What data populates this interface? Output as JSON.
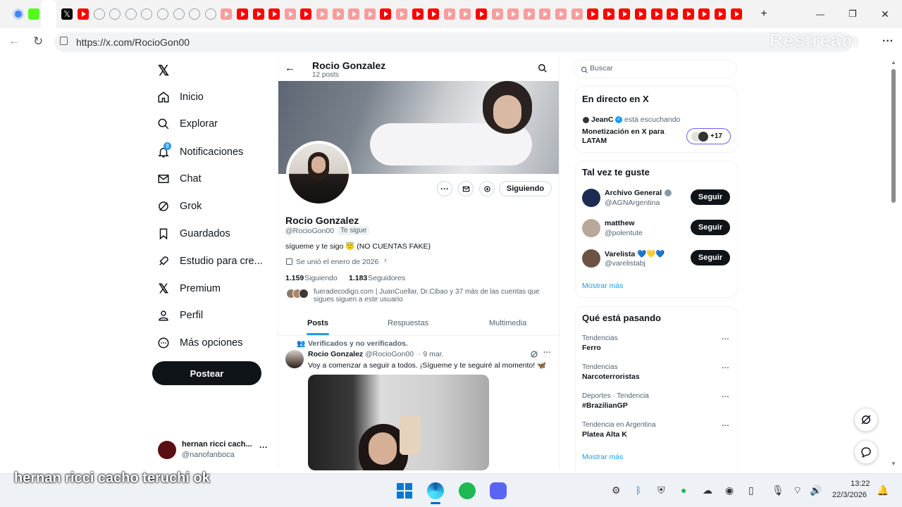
{
  "browser": {
    "url": "https://x.com/RocioGon00",
    "watermark": "Restream",
    "new_tab": "+",
    "min": "—",
    "restore": "❐",
    "close": "✕"
  },
  "nav": {
    "items": [
      {
        "label": "Inicio",
        "icon": "home-icon"
      },
      {
        "label": "Explorar",
        "icon": "search-icon"
      },
      {
        "label": "Notificaciones",
        "icon": "bell-icon",
        "badge": "8"
      },
      {
        "label": "Chat",
        "icon": "mail-icon"
      },
      {
        "label": "Grok",
        "icon": "grok-icon"
      },
      {
        "label": "Guardados",
        "icon": "bookmark-icon"
      },
      {
        "label": "Estudio para cre...",
        "icon": "rocket-icon"
      },
      {
        "label": "Premium",
        "icon": "x-logo-icon"
      },
      {
        "label": "Perfil",
        "icon": "person-icon"
      },
      {
        "label": "Más opciones",
        "icon": "more-circle-icon"
      }
    ],
    "post_label": "Postear",
    "account": {
      "name": "hernan ricci cach...",
      "handle": "@nanofanboca",
      "more": "···"
    }
  },
  "profile": {
    "header_name": "Rocio Gonzalez",
    "post_count": "12 posts",
    "name": "Rocio Gonzalez",
    "handle": "@RocioGon00",
    "follows_you": "Te sigue",
    "bio": "sígueme y te sigo 😇 (NO CUENTAS FAKE)",
    "joined": "Se unió el enero de 2026",
    "following_count": "1.159",
    "following_label": "Siguiendo",
    "followers_count": "1.183",
    "followers_label": "Seguidores",
    "followed_by": "fueradecodigo.com | JuanCuellar, Dr.Cibao y 37 más de las cuentas que sigues siguen a este usuario",
    "follow_state": "Siguiendo",
    "tabs": [
      "Posts",
      "Respuestas",
      "Multimedia"
    ]
  },
  "post": {
    "context": "Verificados y no verificados.",
    "author": "Rocio Gonzalez",
    "handle": "@RocioGon00",
    "date": "· 9 mar.",
    "text": "Voy a comenzar a seguir a todos. ¡Sígueme y te seguiré al momento! 🦋",
    "more": "···"
  },
  "right": {
    "search_placeholder": "Buscar",
    "live": {
      "title": "En directo en X",
      "host": "JeanC",
      "status": "está escuchando",
      "space_title": "Monetización en X para LATAM",
      "count": "+17"
    },
    "suggestions": {
      "title": "Tal vez te guste",
      "users": [
        {
          "name": "Archivo General",
          "handle": "@AGNArgentina",
          "button": "Seguir"
        },
        {
          "name": "matthew",
          "handle": "@polentute",
          "button": "Seguir"
        },
        {
          "name": "Varelista 💙💛💙",
          "handle": "@varelistabj",
          "button": "Seguir"
        }
      ],
      "more": "Mostrar más"
    },
    "trends": {
      "title": "Qué está pasando",
      "items": [
        {
          "context": "Tendencias",
          "name": "Ferro"
        },
        {
          "context": "Tendencias",
          "name": "Narcoterroristas"
        },
        {
          "context": "Deportes · Tendencia",
          "name": "#BrazilianGP"
        },
        {
          "context": "Tendencia en Argentina",
          "name": "Platea Alta K"
        }
      ],
      "more": "Mostrar más",
      "dots": "···"
    }
  },
  "overlay": {
    "caption": "hernan ricci cacho teruchi ok"
  },
  "taskbar": {
    "time": "13:22",
    "date": "22/3/2026"
  },
  "colors": {
    "accent": "#1d9bf0",
    "dark": "#0f1419",
    "muted": "#536471"
  }
}
